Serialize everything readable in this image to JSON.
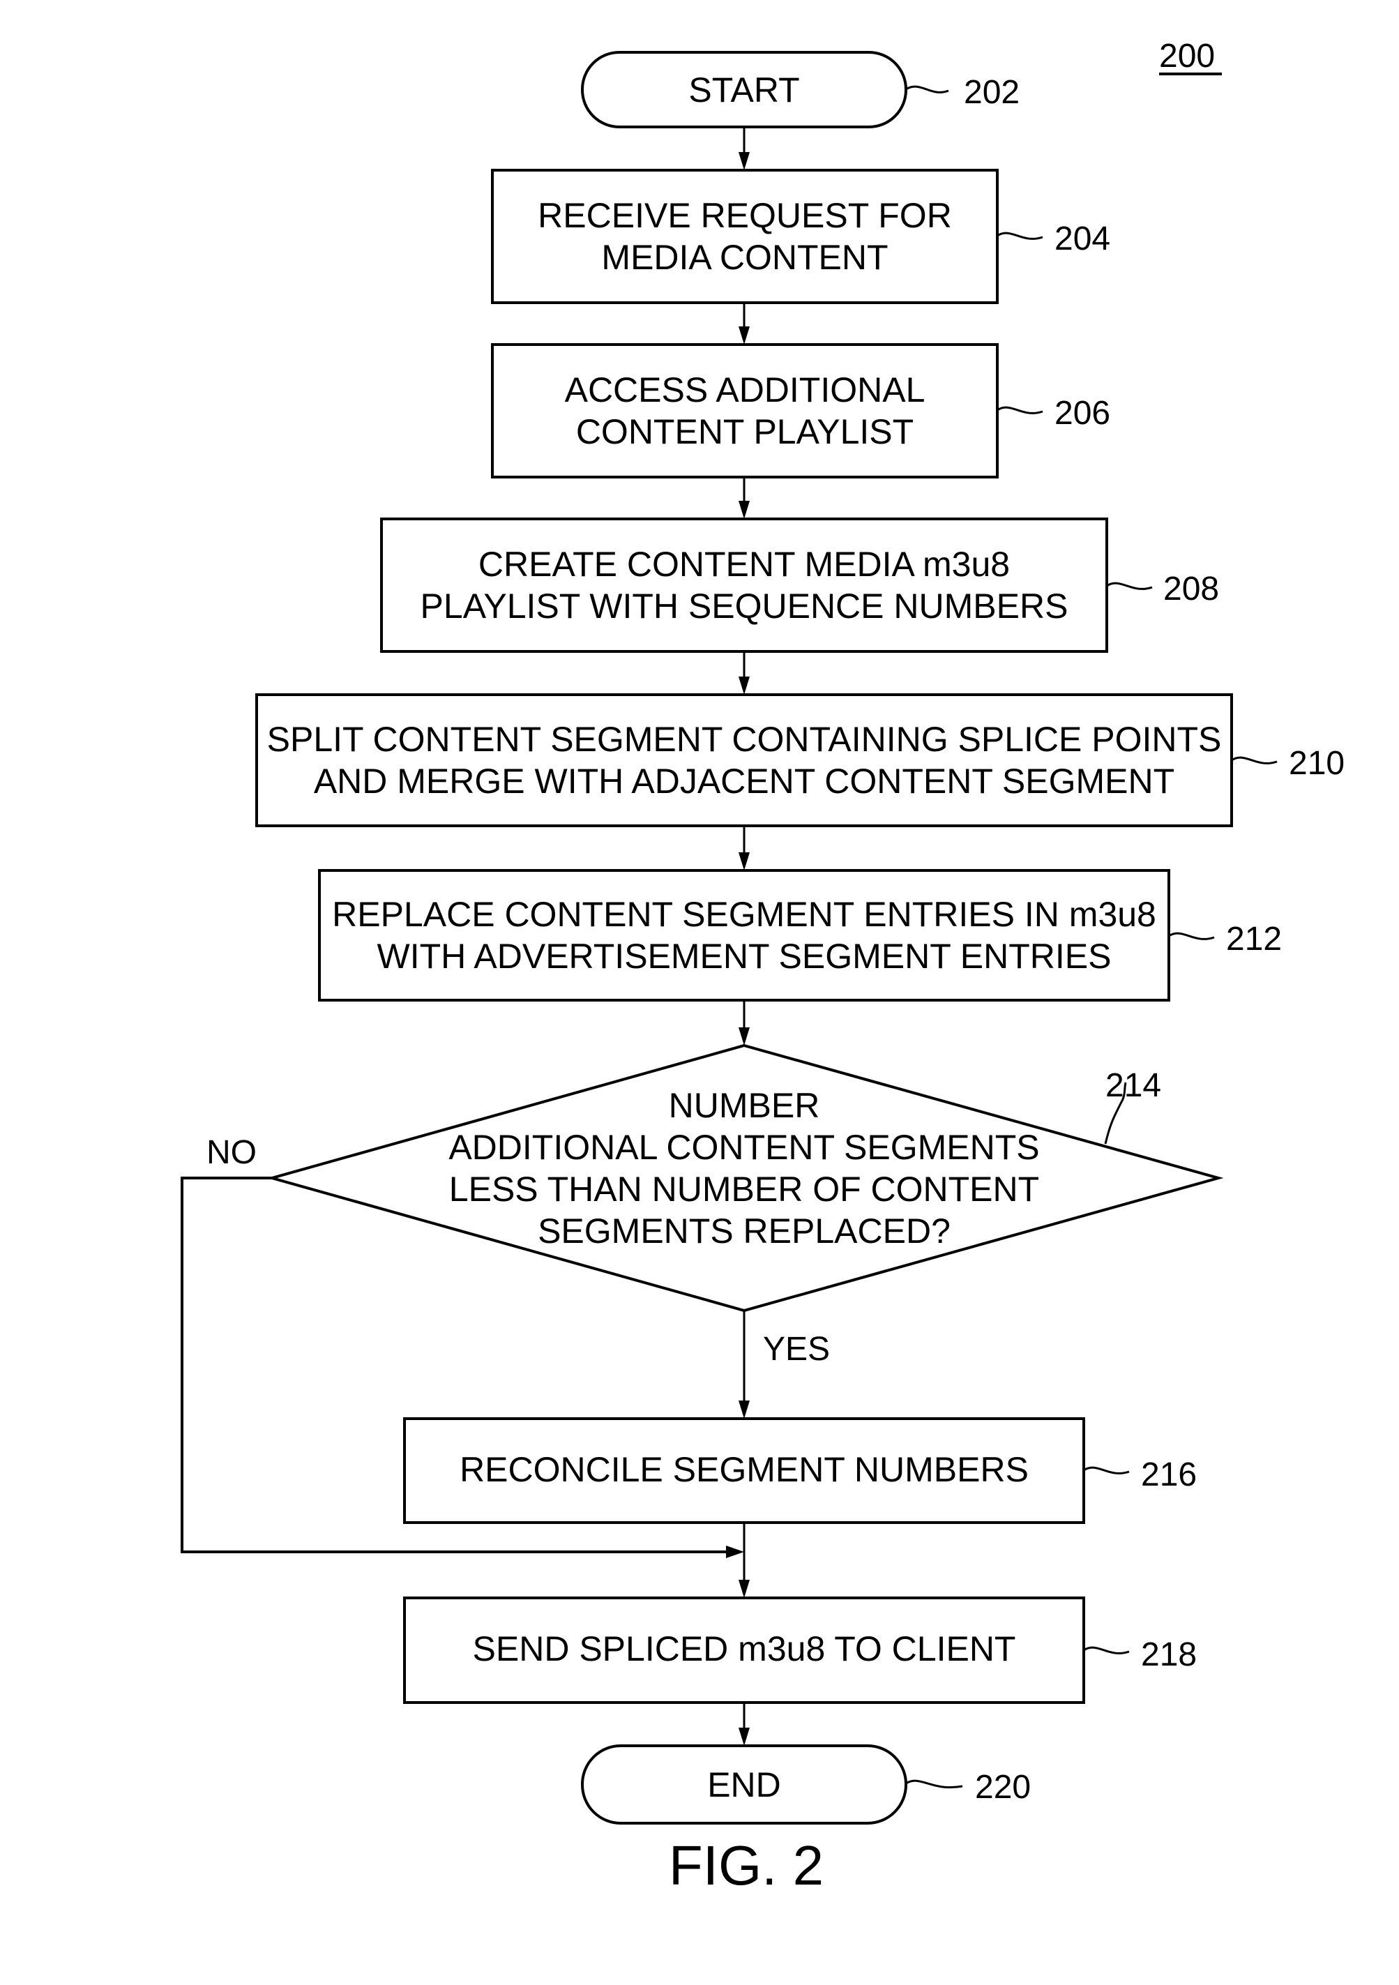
{
  "figure": {
    "number": "200",
    "caption": "FIG. 2"
  },
  "nodes": {
    "start": {
      "ref": "202",
      "lines": [
        "START"
      ]
    },
    "receive": {
      "ref": "204",
      "lines": [
        "RECEIVE REQUEST FOR",
        "MEDIA CONTENT"
      ]
    },
    "access": {
      "ref": "206",
      "lines": [
        "ACCESS ADDITIONAL",
        "CONTENT PLAYLIST"
      ]
    },
    "create": {
      "ref": "208",
      "lines": [
        "CREATE CONTENT MEDIA m3u8",
        "PLAYLIST WITH SEQUENCE NUMBERS"
      ]
    },
    "split": {
      "ref": "210",
      "lines": [
        "SPLIT CONTENT SEGMENT CONTAINING SPLICE POINTS",
        "AND MERGE WITH ADJACENT CONTENT SEGMENT"
      ]
    },
    "replace": {
      "ref": "212",
      "lines": [
        "REPLACE CONTENT SEGMENT ENTRIES IN m3u8",
        "WITH ADVERTISEMENT SEGMENT ENTRIES"
      ]
    },
    "decision": {
      "ref": "214",
      "lines": [
        "NUMBER",
        "ADDITIONAL CONTENT SEGMENTS",
        "LESS THAN NUMBER OF CONTENT",
        "SEGMENTS REPLACED?"
      ],
      "no_label": "NO",
      "yes_label": "YES"
    },
    "reconcile": {
      "ref": "216",
      "lines": [
        "RECONCILE SEGMENT NUMBERS"
      ]
    },
    "send": {
      "ref": "218",
      "lines": [
        "SEND SPLICED m3u8 TO CLIENT"
      ]
    },
    "end": {
      "ref": "220",
      "lines": [
        "END"
      ]
    }
  }
}
